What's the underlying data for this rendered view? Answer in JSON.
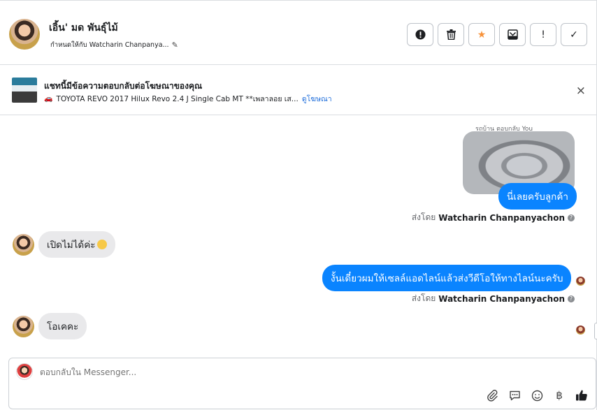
{
  "header": {
    "contact_name": "เอิ้น' มด พันธุ์ไม้",
    "assigned_text": "กำหนดให้กับ Watcharin Chanpanya...",
    "actions": [
      {
        "icon": "alert-circle-icon",
        "glyph": "!"
      },
      {
        "icon": "trash-icon"
      },
      {
        "icon": "star-icon",
        "glyph": "★"
      },
      {
        "icon": "archive-icon"
      },
      {
        "icon": "exclamation-icon",
        "glyph": "!"
      },
      {
        "icon": "check-icon",
        "glyph": "✓"
      }
    ]
  },
  "ad": {
    "title": "แชทนี้มีข้อความตอบกลับต่อโฆษณาของคุณ",
    "subtitle": "TOYOTA REVO 2017 Hilux Revo 2.4 J Single Cab MT **เพลาลอย เส...",
    "link": "ดูโฆษณา",
    "close": "×"
  },
  "thread": {
    "reply_note": "รถบ้าน ตอบกลับ You",
    "messages": [
      {
        "from": "page",
        "text": "นี่เลยครับลูกค้า"
      },
      {
        "from": "contact",
        "text": "เปิดไม่ได้ค่ะ"
      },
      {
        "from": "page",
        "text": "งั้นเดี๋ยวผมให้เซลล์แอดไลน์แล้วส่งวีดีโอให้ทางไลน์นะครับ"
      },
      {
        "from": "contact",
        "text": "โอเคคะ"
      }
    ],
    "sent_by_prefix": "ส่งโดย",
    "sent_by_name": "Watcharin Chanpanyachon",
    "help_glyph": "?"
  },
  "composer": {
    "placeholder": "ตอบกลับใน Messenger...",
    "tools": [
      "paperclip-icon",
      "chat-bubble-icon",
      "smiley-icon",
      "baht-icon",
      "thumbs-up-icon"
    ],
    "baht_glyph": "฿"
  },
  "colors": {
    "accent": "#0a84ff",
    "incoming_bubble": "#e9e9eb",
    "star": "#f7923a",
    "link": "#216fdb"
  }
}
